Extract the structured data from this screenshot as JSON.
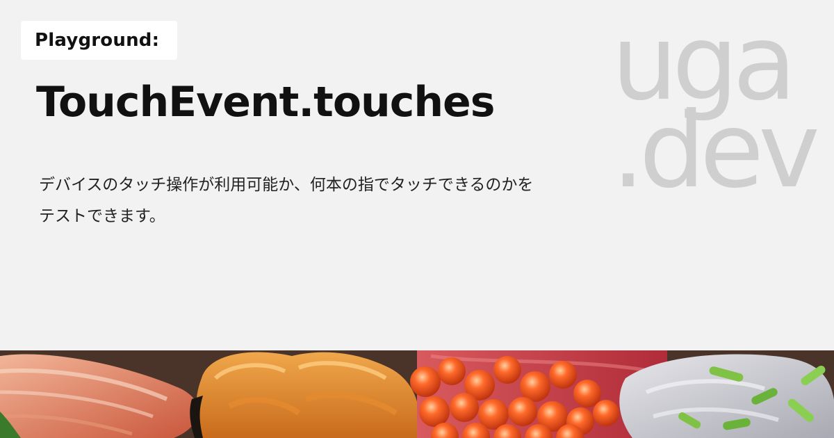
{
  "badge": {
    "label": "Playground:"
  },
  "page": {
    "title": "TouchEvent.touches",
    "description_line1": "デバイスのタッチ操作が利用可能か、何本の指でタッチできるのかを",
    "description_line2": "テストできます。"
  },
  "logo": {
    "line1": "uga",
    "line2": ".dev",
    "color": "#cfcfcf"
  },
  "photo": {
    "subject": "sushi-bowl-photo"
  },
  "colors": {
    "background": "#f2f2f2",
    "badge_bg": "#ffffff",
    "text": "#111111"
  }
}
